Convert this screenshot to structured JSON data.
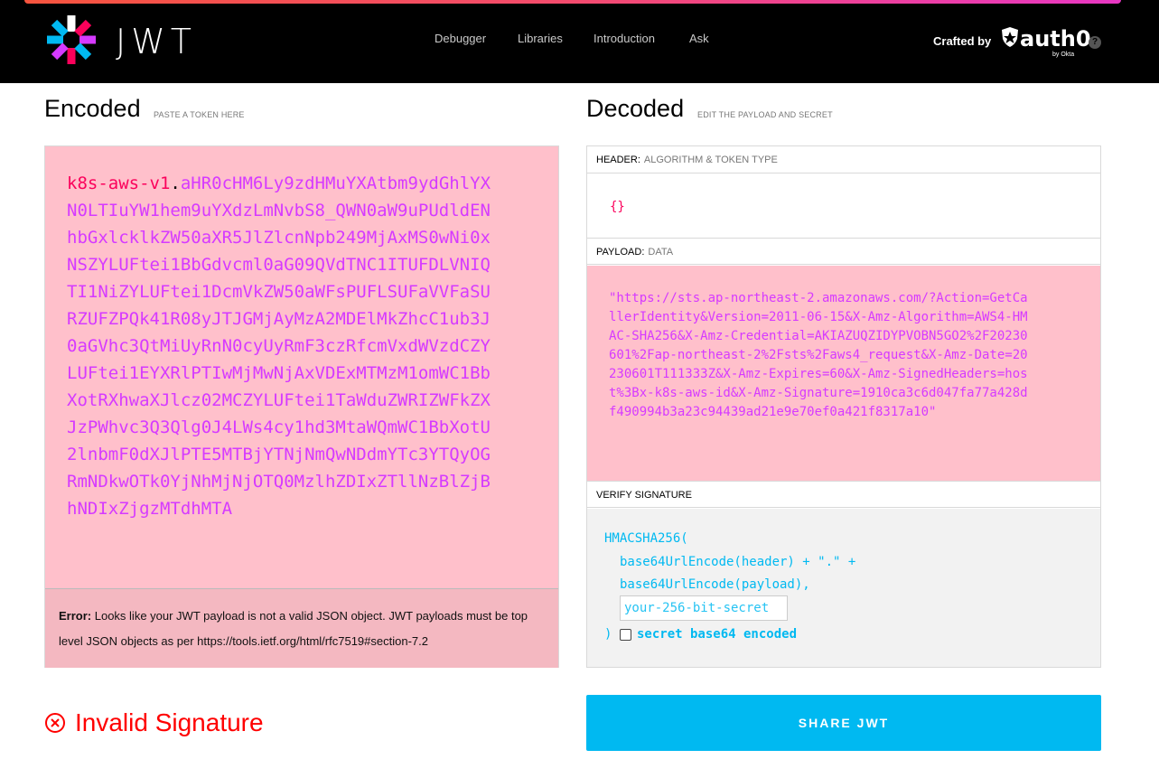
{
  "brand": {
    "logo_text": "JWT",
    "crafted_by": "Crafted by",
    "auth0": "auth0",
    "by_okta": "by Okta"
  },
  "nav": {
    "items": [
      "Debugger",
      "Libraries",
      "Introduction",
      "Ask"
    ]
  },
  "encoded": {
    "title": "Encoded",
    "subtitle": "PASTE A TOKEN HERE",
    "token_header": "k8s-aws-v1",
    "token_dot": ".",
    "token_payload": "aHR0cHM6Ly9zdHMuYXAtbm9ydGhlYXN0LTIuYW1hem9uYXdzLmNvbS8_QWN0aW9uPUdldENhbGxlcklkZW50aXR5JlZlcnNpb249MjAxMS0wNi0xNSZYLUFtei1BbGdvcml0aG09QVdTNC1ITUFDLVNIQTI1NiZYLUFtei1DcmVkZW50aWFsPUFLSUFaVVFaSURZUFZPQk41R08yJTJGMjAyMzA2MDElMkZhcC1ub3J0aGVhc3QtMiUyRnN0cyUyRmF3czRfcmVxdWVzdCZYLUFtei1EYXRlPTIwMjMwNjAxVDExMTMzM1omWC1BbXotRXhwaXJlcz02MCZYLUFtei1TaWduZWRIZWFkZXJzPWhvc3Q3Qlg0J4LWs4cy1hd3MtaWQmWC1BbXotU2lnbmF0dXJlPTE5MTBjYTNjNmQwNDdmYTc3YTQyOGRmNDkwOTk0YjNhMjNjOTQ0MzlhZDIxZTllNzBlZjBhNDIxZjgzMTdhMTA",
    "error_label": "Error:",
    "error_message": " Looks like your JWT payload is not a valid JSON object. JWT payloads must be top level JSON objects as per https://tools.ietf.org/html/rfc7519#section-7.2"
  },
  "decoded": {
    "title": "Decoded",
    "subtitle": "EDIT THE PAYLOAD AND SECRET",
    "header_label": "HEADER:",
    "header_sub": "ALGORITHM & TOKEN TYPE",
    "header_json": "{}",
    "payload_label": "PAYLOAD:",
    "payload_sub": "DATA",
    "payload_json": "\"https://sts.ap-northeast-2.amazonaws.com/?Action=GetCallerIdentity&Version=2011-06-15&X-Amz-Algorithm=AWS4-HMAC-SHA256&X-Amz-Credential=AKIAZUQZIDYPVOBN5GO2%2F20230601%2Fap-northeast-2%2Fsts%2Faws4_request&X-Amz-Date=20230601T111333Z&X-Amz-Expires=60&X-Amz-SignedHeaders=host%3Bx-k8s-aws-id&X-Amz-Signature=1910ca3c6d047fa77a428df490994b3a23c94439ad21e9e70ef0a421f8317a10\"",
    "verify_label": "VERIFY SIGNATURE",
    "verify_line1": "HMACSHA256(",
    "verify_line2": "base64UrlEncode(header) + \".\" +",
    "verify_line3": "base64UrlEncode(payload),",
    "secret_placeholder": "your-256-bit-secret",
    "verify_close": ")",
    "checkbox_label": "secret base64 encoded"
  },
  "status": {
    "invalid_signature": "Invalid Signature"
  },
  "share_button": "SHARE JWT",
  "colors": {
    "accent": "#00b9f1",
    "header_red": "#fb015b",
    "payload_purple": "#d63aff",
    "error_red": "#ff0000"
  }
}
